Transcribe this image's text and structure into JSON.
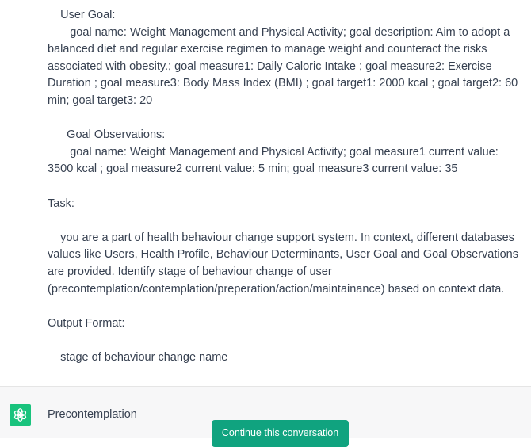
{
  "user_message": {
    "text": "    User Goal:\n       goal name: Weight Management and Physical Activity; goal description: Aim to adopt a balanced diet and regular exercise regimen to manage weight and counteract the risks associated with obesity.; goal measure1: Daily Caloric Intake ; goal measure2: Exercise Duration ; goal measure3: Body Mass Index (BMI) ; goal target1: 2000 kcal ; goal target2: 60 min; goal target3: 20\n\n      Goal Observations:\n       goal name: Weight Management and Physical Activity; goal measure1 current value: 3500 kcal ; goal measure2 current value: 5 min; goal measure3 current value: 35\n\nTask:\n\n    you are a part of health behaviour change support system. In context, different databases values like Users, Health Profile, Behaviour Determinants, User Goal and Goal Observations are provided. Identify stage of behaviour change of user (precontemplation/contemplation/preperation/action/maintainance) based on context data.\n\nOutput Format:\n\n    stage of behaviour change name"
  },
  "assistant_message": {
    "avatar_icon": "openai-logo-icon",
    "avatar_color": "#19c37d",
    "text": "Precontemplation"
  },
  "continue_button": {
    "label": "Continue this conversation",
    "color": "#10a37f"
  }
}
